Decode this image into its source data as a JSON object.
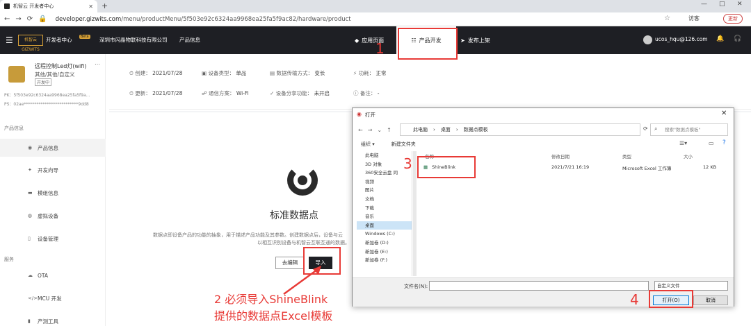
{
  "browser": {
    "tab_title": "机智云 开发者中心",
    "new_tab": "+",
    "url_host": "developer.gizwits.com",
    "url_path": "/menu/productMenu/5f503e92c6324aa9968ea25fa5f9ac82/hardware/product",
    "guest": "访客",
    "update": "更新"
  },
  "topbar": {
    "logo": "机智云 GIZWITS",
    "dev_center": "开发者中心",
    "beta": "Beta",
    "company": "深圳市闪晶物联科技有限公司",
    "product_info": "产品信息",
    "nav": [
      "应用页面",
      "产品开发",
      "发布上架"
    ],
    "user_email": "ucos_hqu@126.com"
  },
  "sidebar": {
    "product_name": "远程控制Led灯(wifi)",
    "product_category": "其他/其他/自定义",
    "product_tag": "开发中",
    "pk": "PK：5f503e92c6324aa9968ea25fa5f9a...",
    "ps": "PS：02ae**************************9dd8",
    "section_info": "产品信息",
    "items": [
      "产品信息",
      "开发向导",
      "模组信息",
      "虚拟设备",
      "设备管理"
    ],
    "section_service": "服务",
    "service_items": [
      "OTA",
      "MCU 开发",
      "产测工具"
    ]
  },
  "info": {
    "row1": [
      {
        "label": "创建：",
        "value": "2021/07/28"
      },
      {
        "label": "设备类型：",
        "value": "单品"
      },
      {
        "label": "数据传输方式：",
        "value": "变长"
      },
      {
        "label": "功耗：",
        "value": "正常"
      }
    ],
    "row2": [
      {
        "label": "更新：",
        "value": "2021/07/28"
      },
      {
        "label": "通信方案：",
        "value": "Wi-Fi"
      },
      {
        "label": "设备分享功能：",
        "value": "未开启"
      },
      {
        "label": "备注：",
        "value": "-"
      }
    ]
  },
  "main": {
    "title": "标准数据点",
    "desc1": "数据点即设备产品的功能的抽象，用于描述产品功能及其参数。创建数据点后，设备与云",
    "desc2": "以相互识别设备与机智云互联互通的数据。",
    "edit_button": "去编辑",
    "import_button": "导入"
  },
  "annotations": {
    "n1": "1",
    "n3": "3",
    "n4": "4",
    "note1": "2 必须导入ShineBlink",
    "note2": "提供的数据点Excel模板",
    "color": "#e83a36"
  },
  "dialog": {
    "title": "打开",
    "path": [
      "此电脑",
      "桌面",
      "数据点模板"
    ],
    "search_placeholder": "搜索\"数据点模板\"",
    "organize": "组织 ▾",
    "new_folder": "新建文件夹",
    "tree": [
      "此电脑",
      "3D 对象",
      "360安全云盘 同",
      "视频",
      "图片",
      "文档",
      "下载",
      "音乐",
      "桌面",
      "Windows (C:)",
      "新加卷 (D:)",
      "新加卷 (E:)",
      "新加卷 (F:)"
    ],
    "columns": [
      "名称",
      "修改日期",
      "类型",
      "大小"
    ],
    "file": {
      "name": "ShineBlink",
      "date": "2021/7/21 16:19",
      "type": "Microsoft Excel 工作簿",
      "size": "12 KB"
    },
    "filename_label": "文件名(N):",
    "filetype": "自定义文件",
    "open": "打开(O)",
    "cancel": "取消"
  }
}
